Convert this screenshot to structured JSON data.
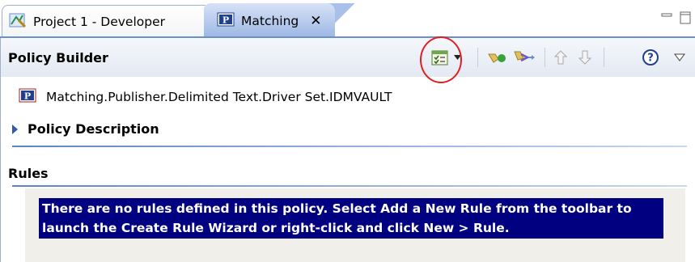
{
  "tabs": [
    {
      "label": "Project 1 - Developer",
      "icon": "developer-perspective-icon",
      "active": false
    },
    {
      "label": "Matching",
      "icon": "policy-p-icon",
      "active": true
    }
  ],
  "window_controls": {
    "minimize": "minimize-icon",
    "maximize": "maximize-icon"
  },
  "header": {
    "title": "Policy Builder",
    "toolbar": [
      "add-new-rule-icon",
      "dropdown-arrow-icon",
      "enable-rule-icon",
      "simulate-icon",
      "move-up-icon",
      "move-down-icon",
      "help-icon",
      "view-menu-icon"
    ]
  },
  "policy": {
    "icon_letter": "P",
    "name": "Matching.Publisher.Delimited Text.Driver Set.IDMVAULT"
  },
  "description_section": {
    "label": "Policy Description"
  },
  "rules_section": {
    "label": "Rules",
    "empty_message": "There are no rules defined in this policy. Select Add a New Rule from the toolbar to launch the Create Rule Wizard or right-click and click New > Rule."
  },
  "colors": {
    "accent": "#6b8fc9",
    "highlight_circle": "#e02020",
    "message_background": "#000080",
    "message_text": "#ffffff"
  }
}
